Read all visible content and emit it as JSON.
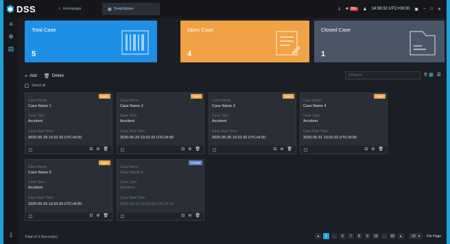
{
  "app": {
    "name": "DSS"
  },
  "tabs": [
    {
      "label": "Homepage",
      "icon": "home-icon"
    },
    {
      "label": "DeepXplore",
      "icon": "grid-icon"
    }
  ],
  "titlebar": {
    "alarm_count": "99+",
    "time": "14:06:32 UTC+08:00"
  },
  "sidebar": {
    "items": [
      "menu-icon",
      "search-icon",
      "case-icon"
    ],
    "bottom": "export-icon"
  },
  "stats": [
    {
      "title": "Total Case",
      "count": "5",
      "color": "#1f8fe6",
      "icon": "barcode-icon"
    },
    {
      "title": "Open Case",
      "count": "4",
      "color": "#f0a245",
      "icon": "document-edit-icon"
    },
    {
      "title": "Closed Case",
      "count": "1",
      "color": "#4a5566",
      "icon": "folder-icon"
    }
  ],
  "toolbar": {
    "add_label": "Add",
    "delete_label": "Delete",
    "search_placeholder": "ID/Name"
  },
  "select_all": "Select all",
  "labels": {
    "case_name": "Case Name:",
    "case_type": "Case Type:",
    "start_time": "Case Start Time:"
  },
  "cases": [
    {
      "name": "Case Name 1",
      "type": "Accident",
      "start": "2020-05-28 10:32:33 UTC+8:00",
      "status": "Open",
      "status_color": "#f0a245"
    },
    {
      "name": "Case Name 2",
      "type": "Accident",
      "start": "2020-05-29 10:32:33 UTC+8:00",
      "status": "Open",
      "status_color": "#f0a245"
    },
    {
      "name": "Case Name 3",
      "type": "Accident",
      "start": "2020-05-30 10:32:33 UTC+8:00",
      "status": "Open",
      "status_color": "#f0a245"
    },
    {
      "name": "Case Name 4",
      "type": "Accident",
      "start": "2020-05-31 10:32:33 UTC+8:00",
      "status": "Open",
      "status_color": "#f0a245"
    },
    {
      "name": "Case Name 5",
      "type": "Accident",
      "start": "2020-05-32 10:32:33 UTC+8:00",
      "status": "Open",
      "status_color": "#f0a245"
    },
    {
      "name": "Case Name 6",
      "type": "Accident",
      "start": "2020-05-33 10:32:33 UTC+8:00",
      "status": "Closed",
      "status_color": "#5b7fc4"
    }
  ],
  "footer": {
    "total": "Total of 5 Record(s)",
    "pages": [
      "1",
      "...",
      "6",
      "7",
      "8",
      "9",
      "10",
      "...",
      "50"
    ],
    "per_page": "20",
    "per_page_label": "Per Page"
  }
}
